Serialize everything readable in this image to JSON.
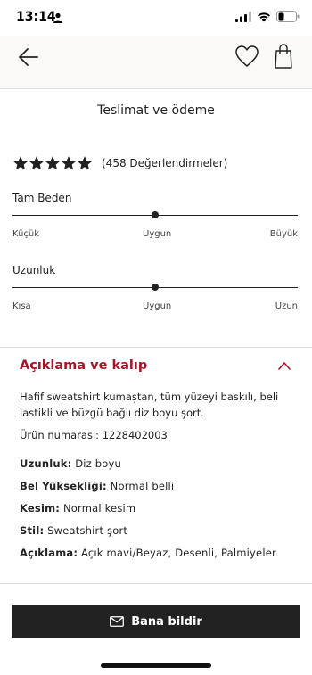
{
  "status": {
    "time": "13:14"
  },
  "header": {
    "back_icon": "arrow-left-icon",
    "wishlist_icon": "heart-icon",
    "bag_icon": "shopping-bag-icon"
  },
  "delivery": {
    "label": "Teslimat ve ödeme"
  },
  "rating": {
    "stars": 5,
    "text": "(458 Değerlendirmeler)"
  },
  "fit": {
    "size": {
      "label": "Tam Beden",
      "min": "Küçük",
      "mid": "Uygun",
      "max": "Büyük",
      "level": 0.5
    },
    "length": {
      "label": "Uzunluk",
      "min": "Kısa",
      "mid": "Uygun",
      "max": "Uzun",
      "level": 0.5
    }
  },
  "description": {
    "title": "Açıklama ve kalıp",
    "text": "Hafif sweatshirt kumaştan, tüm yüzeyi baskılı, beli lastikli ve büzgü bağlı diz boyu şort.",
    "product_number": "Ürün numarası: 1228402003",
    "attributes": [
      {
        "key": "Uzunluk:",
        "value": "Diz boyu"
      },
      {
        "key": "Bel Yüksekliği:",
        "value": "Normal belli"
      },
      {
        "key": "Kesim:",
        "value": "Normal kesim"
      },
      {
        "key": "Stil:",
        "value": "Sweatshirt şort"
      },
      {
        "key": "Açıklama:",
        "value": "Açık mavi/Beyaz, Desenli, Palmiyeler"
      }
    ]
  },
  "cta": {
    "label": "Bana bildir",
    "icon": "envelope-icon"
  },
  "colors": {
    "accent": "#a3162a",
    "dark": "#222222",
    "header_bg": "#faf9f8"
  }
}
